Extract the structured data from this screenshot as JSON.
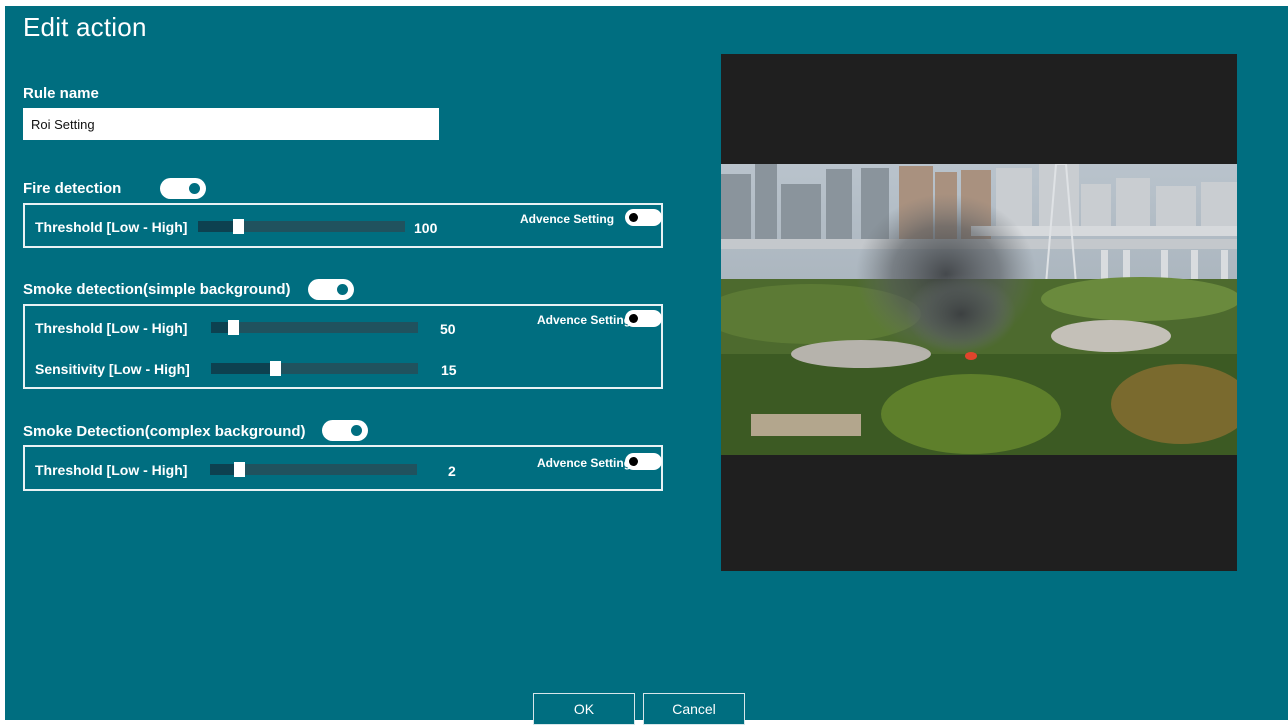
{
  "dialog": {
    "title": "Edit action",
    "rule_name_label": "Rule name",
    "rule_name_value": "Roi Setting"
  },
  "fire": {
    "title": "Fire detection",
    "enabled": true,
    "advanced_label": "Advence Setting",
    "threshold_label": "Threshold [Low - High]",
    "threshold_value": "100"
  },
  "smoke_simple": {
    "title": "Smoke detection(simple background)",
    "enabled": true,
    "advanced_label": "Advence Setting",
    "threshold_label": "Threshold [Low - High]",
    "threshold_value": "50",
    "sensitivity_label": "Sensitivity [Low - High]",
    "sensitivity_value": "15"
  },
  "smoke_complex": {
    "title": "Smoke Detection(complex background)",
    "enabled": true,
    "advanced_label": "Advence Setting",
    "threshold_label": "Threshold [Low - High]",
    "threshold_value": "2"
  },
  "buttons": {
    "ok": "OK",
    "cancel": "Cancel"
  },
  "colors": {
    "background": "#006e80",
    "track": "#20525e",
    "preview_bg": "#1f1f1f"
  }
}
